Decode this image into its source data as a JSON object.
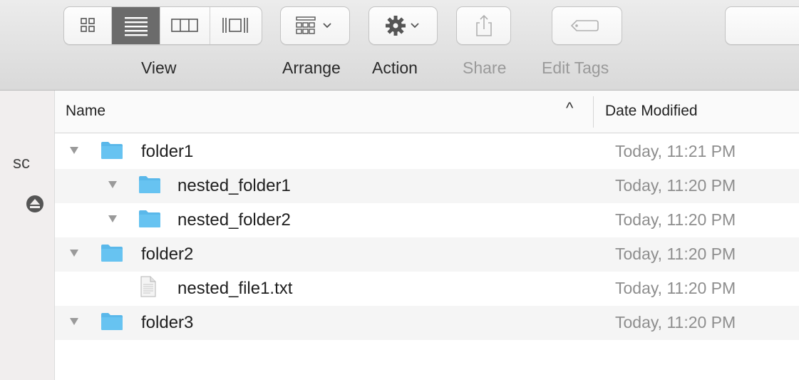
{
  "toolbar": {
    "view_label": "View",
    "arrange_label": "Arrange",
    "action_label": "Action",
    "share_label": "Share",
    "edit_tags_label": "Edit Tags"
  },
  "sidebar": {
    "fragment_text": "sc"
  },
  "list": {
    "columns": {
      "name": "Name",
      "date_modified": "Date Modified",
      "sort_indicator": "^"
    },
    "rows": [
      {
        "name": "folder1",
        "date": "Today, 11:21 PM",
        "kind": "folder",
        "depth": 0,
        "expanded": true
      },
      {
        "name": "nested_folder1",
        "date": "Today, 11:20 PM",
        "kind": "folder",
        "depth": 1,
        "expanded": true
      },
      {
        "name": "nested_folder2",
        "date": "Today, 11:20 PM",
        "kind": "folder",
        "depth": 1,
        "expanded": true
      },
      {
        "name": "folder2",
        "date": "Today, 11:20 PM",
        "kind": "folder",
        "depth": 0,
        "expanded": true
      },
      {
        "name": "nested_file1.txt",
        "date": "Today, 11:20 PM",
        "kind": "file",
        "depth": 1,
        "expanded": false
      },
      {
        "name": "folder3",
        "date": "Today, 11:20 PM",
        "kind": "folder",
        "depth": 0,
        "expanded": true
      }
    ]
  },
  "colors": {
    "folder_blue": "#5ab8ea",
    "selected_segment": "#6b6b6b",
    "date_text": "#8e8e8e"
  }
}
